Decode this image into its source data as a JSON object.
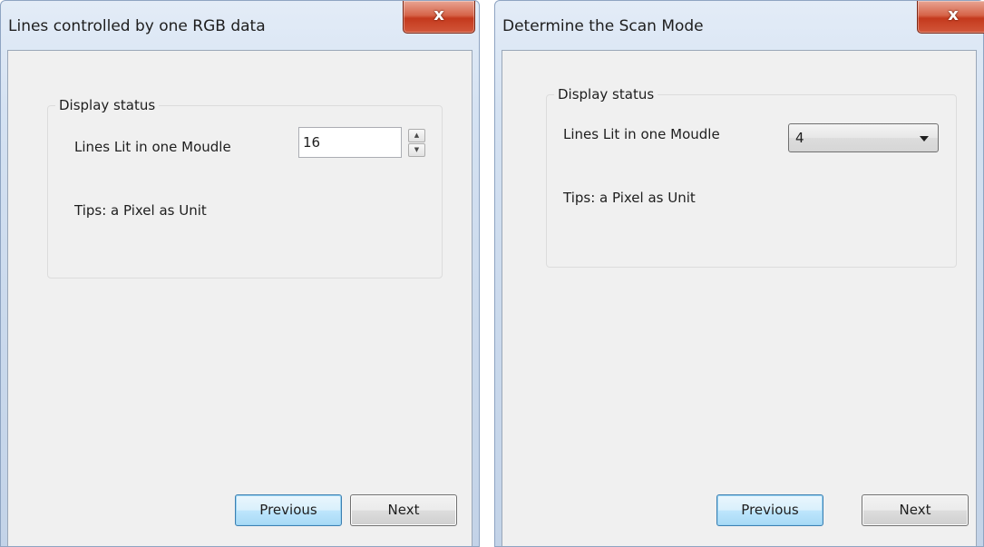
{
  "dialog_lines": {
    "title": "Lines controlled by one RGB data",
    "close_label": "x",
    "group_label": "Display status",
    "lines_label": "Lines Lit in one Moudle",
    "lines_value": "16",
    "spin_up_icon": "triangle-up",
    "spin_down_icon": "triangle-down",
    "tips": "Tips: a Pixel as Unit",
    "previous_label": "Previous",
    "next_label": "Next"
  },
  "dialog_scan": {
    "title": "Determine the Scan Mode",
    "close_label": "x",
    "group_label": "Display status",
    "lines_label": "Lines Lit in one Moudle",
    "lines_selected": "4",
    "dropdown_icon": "chevron-down",
    "tips": "Tips: a Pixel as Unit",
    "previous_label": "Previous",
    "next_label": "Next"
  },
  "colors": {
    "accent_default_button": "#a7d9f5",
    "close_button": "#c4391d",
    "client_background": "#f0f0f0"
  }
}
